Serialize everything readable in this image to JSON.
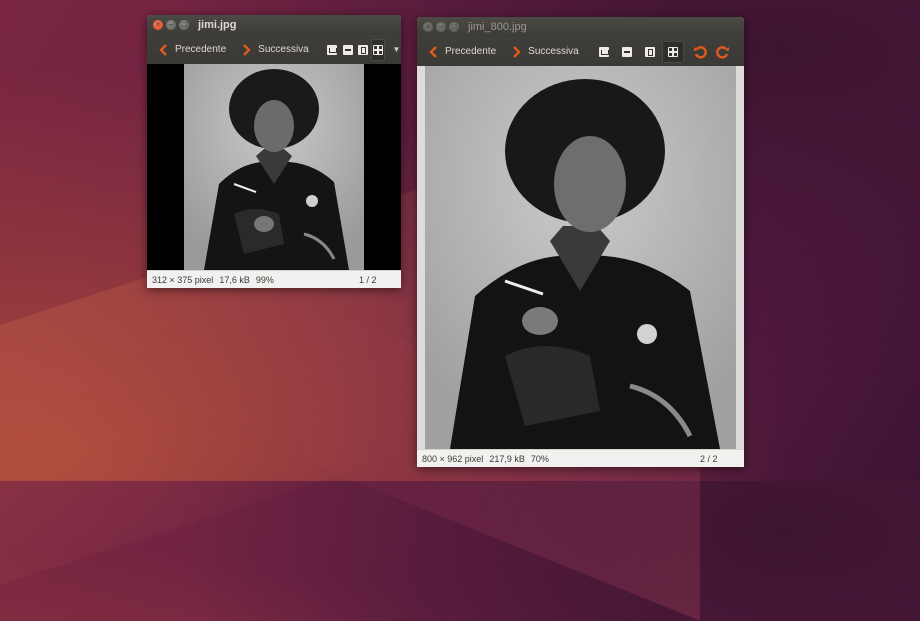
{
  "window_a": {
    "title": "jimi.jpg",
    "nav": {
      "prev": "Precedente",
      "next": "Successiva"
    },
    "toolbar_icons": [
      "home-icon",
      "zoom-out-icon",
      "fit-icon",
      "grid-icon"
    ],
    "status": {
      "dimensions": "312 × 375 pixel",
      "size": "17,6 kB",
      "zoom": "99%",
      "page": "1 / 2"
    }
  },
  "window_b": {
    "title": "jimi_800.jpg",
    "nav": {
      "prev": "Precedente",
      "next": "Successiva"
    },
    "toolbar_icons": [
      "home-icon",
      "zoom-out-icon",
      "fit-icon",
      "grid-icon",
      "rotate-left-icon",
      "rotate-right-icon"
    ],
    "status": {
      "dimensions": "800 × 962 pixel",
      "size": "217,9 kB",
      "zoom": "70%",
      "page": "2 / 2"
    }
  },
  "colors": {
    "accent": "#e05a1e",
    "titlebar": "#3c3b37",
    "statusbar": "#f2f1f0"
  }
}
